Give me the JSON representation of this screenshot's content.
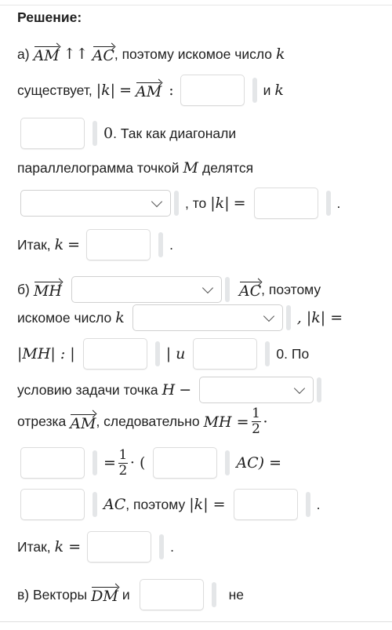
{
  "heading": "Решение:",
  "part_a": {
    "prefix": "а)",
    "vec1": "AM",
    "arrows": "↑↑",
    "vec2": "AC",
    "text1": ", поэтому искомое число",
    "k": "k",
    "text2": "существует,",
    "abs_k": "|k|",
    "eq": "=",
    "vec3": "AM",
    "colon": ":",
    "and": "и",
    "zero": "0",
    "text3": ". Так как диагонали",
    "text4": "параллелограмма точкой",
    "M": "M",
    "text5": "делятся",
    "select_value": "",
    "text6": ", то",
    "dot": ".",
    "itak": "Итак,",
    "inputs": [
      "",
      "",
      "",
      ""
    ]
  },
  "part_b": {
    "prefix": "б)",
    "vec1": "MH",
    "vec2": "AC",
    "text1": ", поэтому",
    "text2": "искомое число",
    "k": "k",
    "comma_absk": ", |k| =",
    "abs_mh": "|MH| : |",
    "and_k": "| и",
    "zero_po": "0. По",
    "text3": "условию задачи точка",
    "H": "H",
    "dash": "−",
    "text4": "отрезка",
    "vec3": "AM",
    "text5": ", следовательно",
    "mh_eq": "MH =",
    "frac_num": "1",
    "frac_den": "2",
    "cdot": "·",
    "eq": "=",
    "open_paren": "· (",
    "ac_close": "AC) =",
    "ac": "AC",
    "text6": ", поэтому",
    "abs_k_eq": "|k| =",
    "dot": ".",
    "itak": "Итак,",
    "k_eq": "k =",
    "selects": [
      "",
      "",
      ""
    ],
    "inputs": [
      "",
      "",
      "",
      "",
      "",
      "",
      "",
      ""
    ]
  },
  "part_c": {
    "prefix": "в) Векторы",
    "vec1": "DM",
    "and": "и",
    "ne": "не",
    "input": ""
  }
}
